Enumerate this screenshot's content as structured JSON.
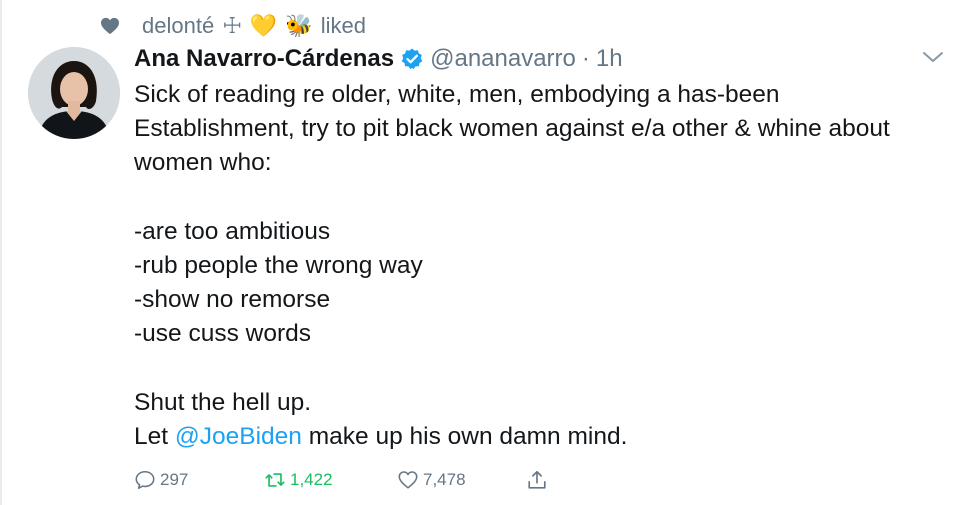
{
  "social_context": {
    "user": "delonté",
    "symbol": "☩",
    "emoji1": "💛",
    "emoji2": "🐝",
    "action": "liked"
  },
  "tweet": {
    "display_name": "Ana Navarro-Cárdenas",
    "handle": "@ananavarro",
    "separator": "·",
    "time": "1h",
    "lines": {
      "l1": "Sick of reading re older, white, men, embodying a has-been",
      "l2": "Establishment, try to pit black women against e/a other & whine about",
      "l3": "women who:",
      "l4": "-are too ambitious",
      "l5": "-rub people the wrong way",
      "l6": "-show no remorse",
      "l7": "-use cuss words",
      "l8": "Shut the hell up.",
      "l9_prefix": "Let ",
      "l9_mention": "@JoeBiden",
      "l9_suffix": " make up his own damn mind."
    },
    "actions": {
      "replies": "297",
      "retweets": "1,422",
      "likes": "7,478"
    }
  },
  "colors": {
    "text": "#14171a",
    "secondary": "#657786",
    "link": "#1da1f2",
    "retweet": "#17bf63"
  }
}
